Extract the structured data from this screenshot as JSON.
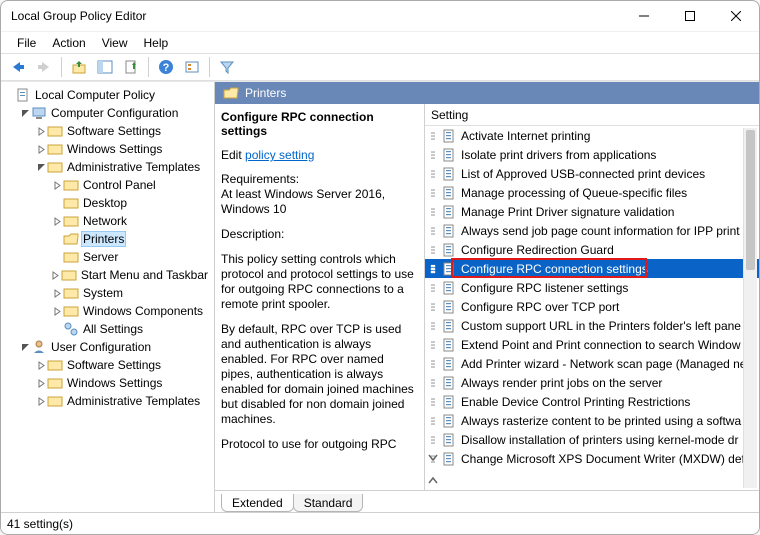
{
  "title": "Local Group Policy Editor",
  "menu": {
    "file": "File",
    "action": "Action",
    "view": "View",
    "help": "Help"
  },
  "tree": {
    "root": "Local Computer Policy",
    "comp": "Computer Configuration",
    "comp_children": {
      "software": "Software Settings",
      "windows": "Windows Settings",
      "admin": "Administrative Templates",
      "admin_children": {
        "control_panel": "Control Panel",
        "desktop": "Desktop",
        "network": "Network",
        "printers": "Printers",
        "server": "Server",
        "start_menu": "Start Menu and Taskbar",
        "system": "System",
        "win_components": "Windows Components",
        "all_settings": "All Settings"
      }
    },
    "user": "User Configuration",
    "user_children": {
      "software": "Software Settings",
      "windows": "Windows Settings",
      "admin": "Administrative Templates"
    }
  },
  "right": {
    "header": "Printers",
    "desc_heading": "Configure RPC connection settings",
    "edit_prefix": "Edit ",
    "edit_link": "policy setting ",
    "req_label": "Requirements:",
    "req_body": "At least Windows Server 2016, Windows 10",
    "desc_label": "Description:",
    "desc_p1": "This policy setting controls which protocol and protocol settings to use for outgoing RPC connections to a remote print spooler.",
    "desc_p2": "By default, RPC over TCP is used and authentication is always enabled. For RPC over named pipes, authentication is always enabled for domain joined machines but disabled for non domain joined machines.",
    "desc_p3": "Protocol to use for outgoing RPC",
    "column": "Setting",
    "items": [
      "Activate Internet printing",
      "Isolate print drivers from applications",
      "List of Approved USB-connected print devices",
      "Manage processing of Queue-specific files",
      "Manage Print Driver signature validation",
      "Always send job page count information for IPP print",
      "Configure Redirection Guard",
      "Configure RPC connection settings",
      "Configure RPC listener settings",
      "Configure RPC over TCP port",
      "Custom support URL in the Printers folder's left pane",
      "Extend Point and Print connection to search Window",
      "Add Printer wizard - Network scan page (Managed ne",
      "Always render print jobs on the server",
      "Enable Device Control Printing Restrictions",
      "Always rasterize content to be printed using a softwa",
      "Disallow installation of printers using kernel-mode dr",
      "Change Microsoft XPS Document Writer (MXDW) def"
    ],
    "selected_index": 7
  },
  "tabs": {
    "extended": "Extended",
    "standard": "Standard"
  },
  "status": "41 setting(s)"
}
